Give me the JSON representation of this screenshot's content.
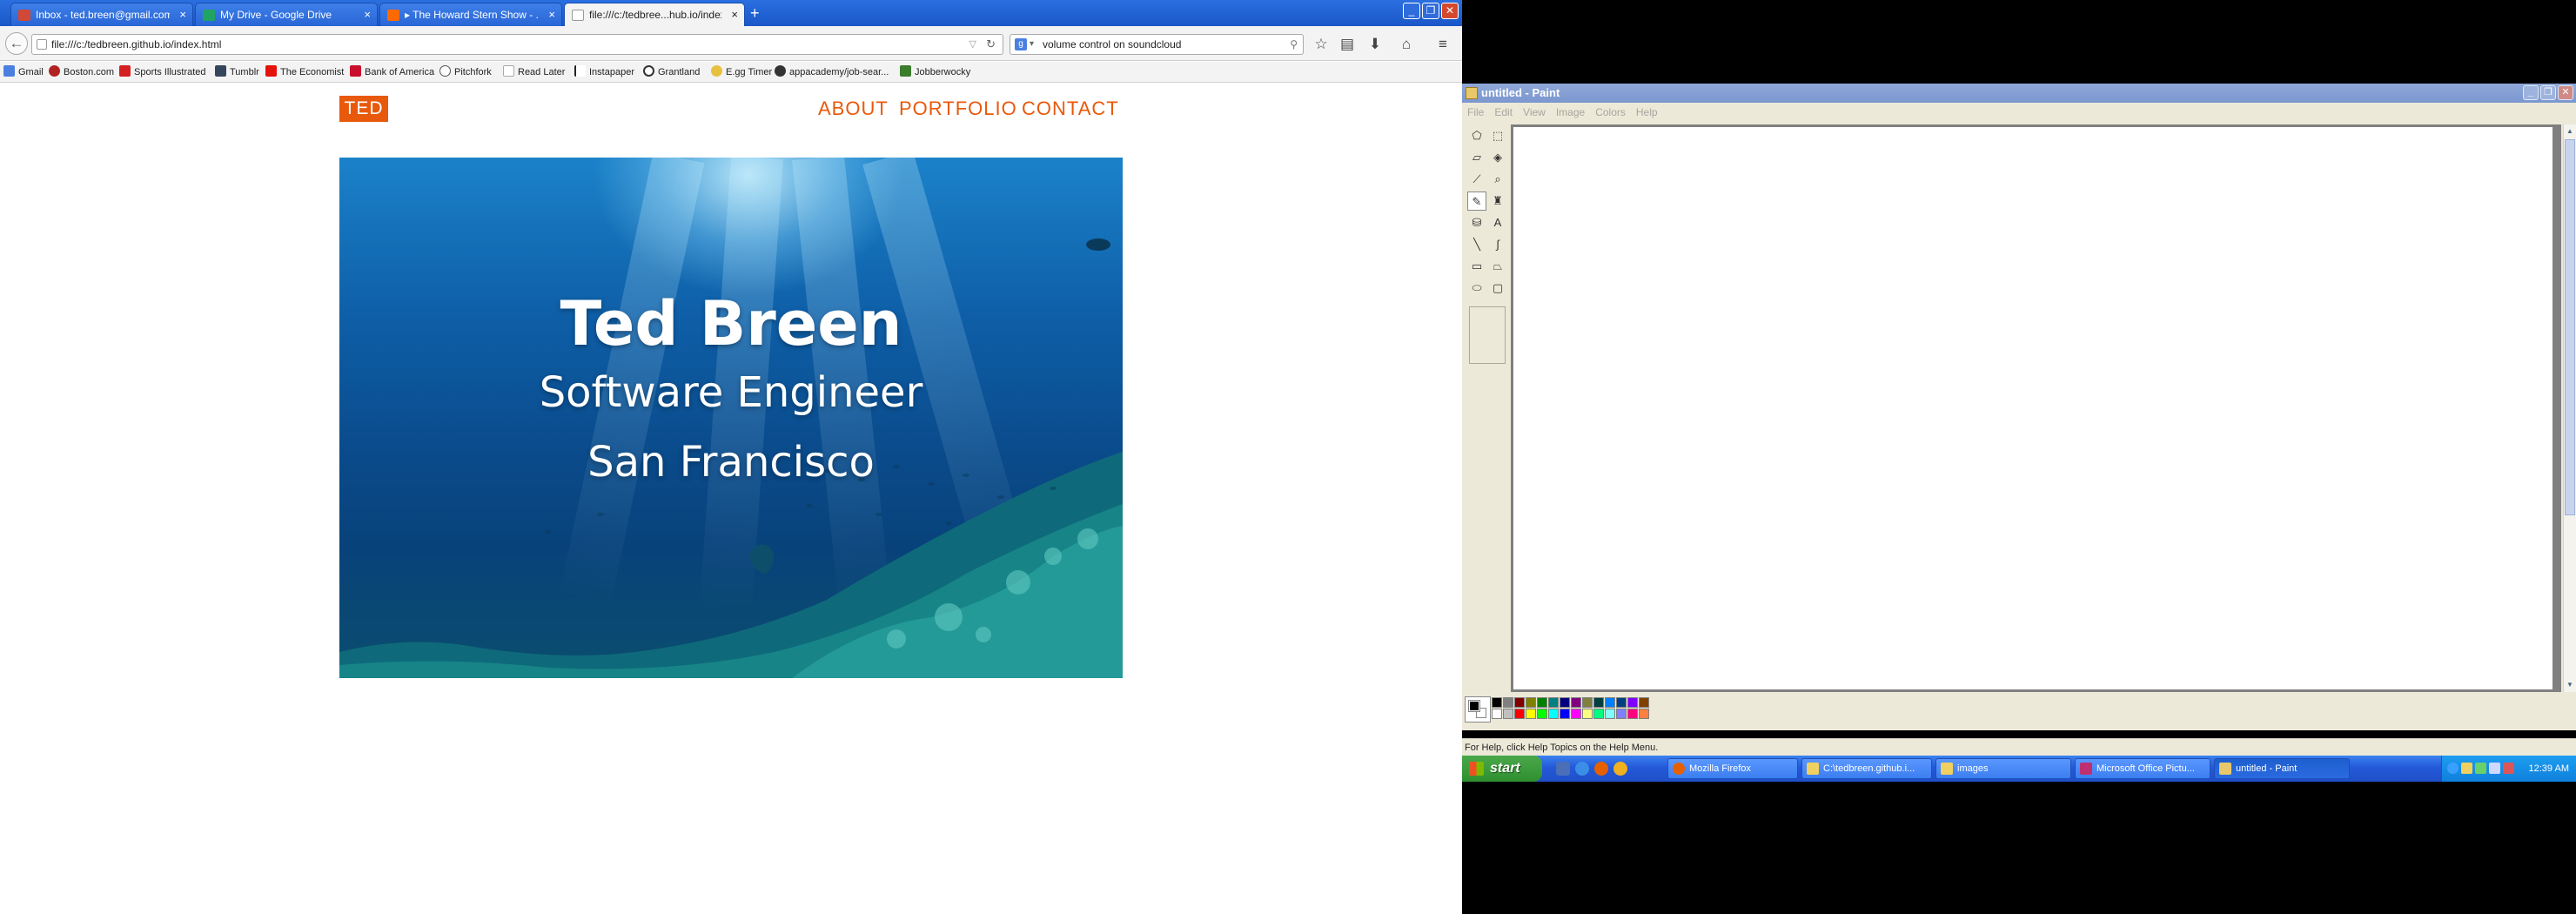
{
  "firefox": {
    "tabs": [
      {
        "label": "Inbox - ted.breen@gmail.com...",
        "favicon_color": "#d14836"
      },
      {
        "label": "My Drive - Google Drive",
        "favicon_color": "#1fa463"
      },
      {
        "label": "▸ The Howard Stern Show - ...",
        "favicon_color": "#ff6a00"
      },
      {
        "label": "file:///c:/tedbree...hub.io/index.html",
        "favicon_color": "#ffffff"
      }
    ],
    "tab_close": "×",
    "new_tab": "+",
    "url": "file:///c:/tedbreen.github.io/index.html",
    "search_query": "volume control on soundcloud",
    "search_engine": "g",
    "bookmarks": [
      {
        "label": "Gmail",
        "color": "#4a80e0"
      },
      {
        "label": "Boston.com",
        "color": "#b22222"
      },
      {
        "label": "Sports Illustrated",
        "color": "#d42020"
      },
      {
        "label": "Tumblr",
        "color": "#35465c"
      },
      {
        "label": "The Economist",
        "color": "#e3120b"
      },
      {
        "label": "Bank of America",
        "color": "#c8102e"
      },
      {
        "label": "Pitchfork",
        "color": "#555555"
      },
      {
        "label": "Read Later",
        "color": "#dddddd"
      },
      {
        "label": "Instapaper",
        "color": "#222222"
      },
      {
        "label": "Grantland",
        "color": "#333333"
      },
      {
        "label": "E.gg Timer",
        "color": "#e8c040"
      },
      {
        "label": "appacademy/job-sear...",
        "color": "#333333"
      },
      {
        "label": "Jobberwocky",
        "color": "#3a7d2c"
      }
    ]
  },
  "page": {
    "logo": "TED",
    "nav": [
      "ABOUT",
      "PORTFOLIO",
      "CONTACT"
    ],
    "hero_name": "Ted Breen",
    "hero_role": "Software Engineer",
    "hero_city": "San Francisco",
    "accent": "#e8590c"
  },
  "paint": {
    "title": "untitled - Paint",
    "menu": [
      "File",
      "Edit",
      "View",
      "Image",
      "Colors",
      "Help"
    ],
    "status": "For Help, click Help Topics on the Help Menu.",
    "palette": [
      "#000000",
      "#808080",
      "#800000",
      "#808000",
      "#008000",
      "#008080",
      "#000080",
      "#800080",
      "#808040",
      "#004040",
      "#0080ff",
      "#004080",
      "#8000ff",
      "#804000",
      "#ffffff",
      "#c0c0c0",
      "#ff0000",
      "#ffff00",
      "#00ff00",
      "#00ffff",
      "#0000ff",
      "#ff00ff",
      "#ffff80",
      "#00ff80",
      "#80ffff",
      "#8080ff",
      "#ff0080",
      "#ff8040"
    ]
  },
  "taskbar": {
    "start": "start",
    "items": [
      {
        "label": "Mozilla Firefox",
        "color": "#e66000"
      },
      {
        "label": "C:\\tedbreen.github.i...",
        "color": "#f0d060"
      },
      {
        "label": "images",
        "color": "#f0d060"
      },
      {
        "label": "Microsoft Office Pictu...",
        "color": "#c03070"
      },
      {
        "label": "untitled - Paint",
        "color": "#e8c86a"
      }
    ],
    "clock": "12:39 AM"
  }
}
